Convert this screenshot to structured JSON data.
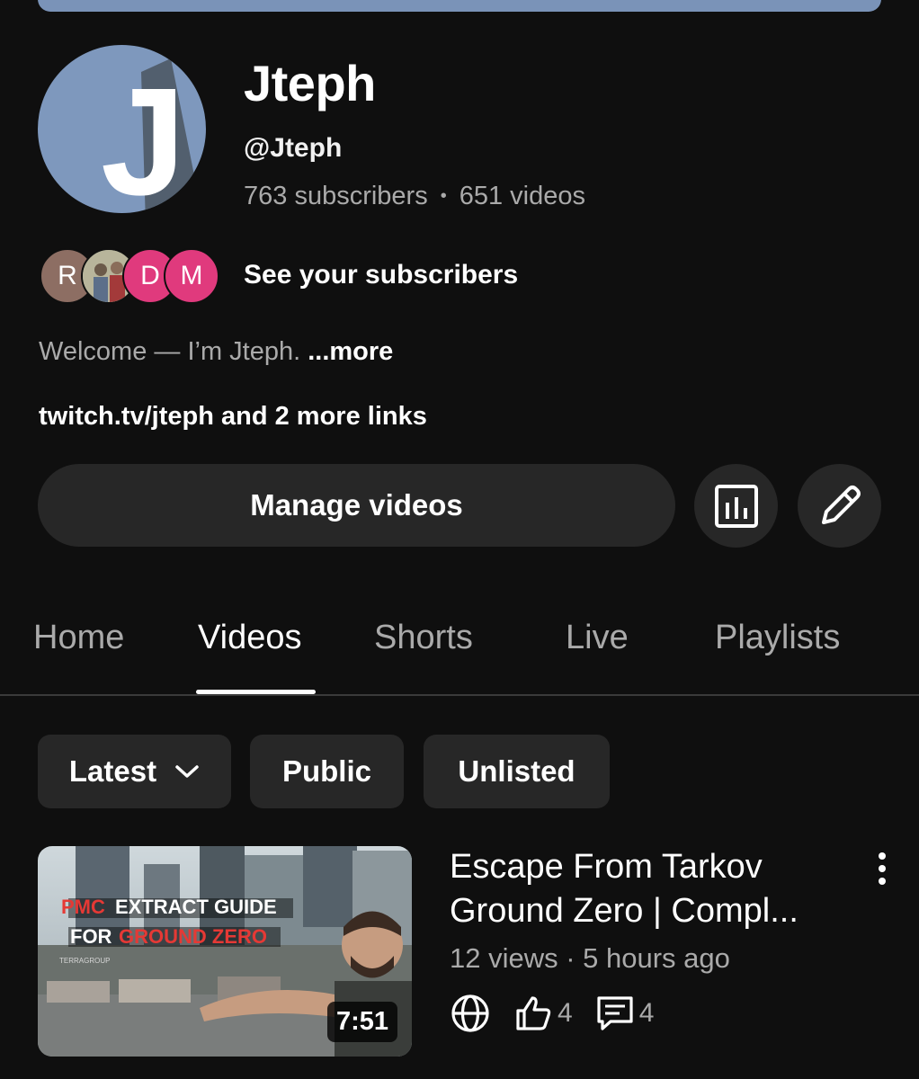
{
  "channel": {
    "avatar_letter": "J",
    "name": "Jteph",
    "handle": "@Jteph",
    "subscribers": "763 subscribers",
    "videos": "651 videos",
    "stats_separator": "•"
  },
  "subscribers_preview": {
    "avatars": [
      {
        "letter": "R",
        "color": "#8d6e63"
      },
      {
        "letter": "",
        "color": "#9aa58a"
      },
      {
        "letter": "D",
        "color": "#e03a7d"
      },
      {
        "letter": "M",
        "color": "#e03a7d"
      }
    ],
    "label": "See your subscribers"
  },
  "description": {
    "text": "Welcome — I’m Jteph. ",
    "more": "...more"
  },
  "links": "twitch.tv/jteph and 2 more links",
  "actions": {
    "manage_label": "Manage videos",
    "analytics_icon": "analytics-icon",
    "edit_icon": "pencil-icon"
  },
  "tabs": [
    {
      "label": "Home",
      "active": false
    },
    {
      "label": "Videos",
      "active": true
    },
    {
      "label": "Shorts",
      "active": false
    },
    {
      "label": "Live",
      "active": false
    },
    {
      "label": "Playlists",
      "active": false
    }
  ],
  "filters": {
    "sort_label": "Latest",
    "public_label": "Public",
    "unlisted_label": "Unlisted"
  },
  "video": {
    "thumb_line1_red": "PMC",
    "thumb_line1_white": "EXTRACT GUIDE",
    "thumb_line2_white": "FOR",
    "thumb_line2_red": "GROUND ZERO",
    "thumb_sign": "TERRAGROUP",
    "duration": "7:51",
    "title": "Escape From Tarkov Ground Zero | Compl...",
    "meta": "12 views · 5 hours ago",
    "likes": "4",
    "comments": "4"
  },
  "colors": {
    "background": "#0f0f0f",
    "surface": "#272727",
    "text_primary": "#f1f1f1",
    "text_secondary": "#aaaaaa",
    "avatar_bg": "#7e98bd",
    "thumb_accent_red": "#e53935"
  }
}
